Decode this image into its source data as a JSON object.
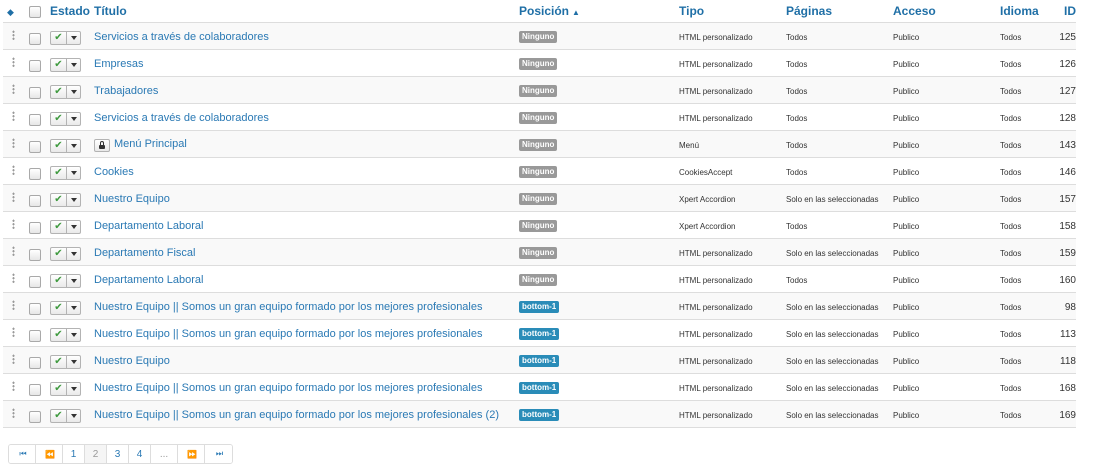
{
  "headers": {
    "estado": "Estado",
    "titulo": "Título",
    "posicion": "Posición",
    "tipo": "Tipo",
    "paginas": "Páginas",
    "acceso": "Acceso",
    "idioma": "Idioma",
    "id": "ID"
  },
  "rows": [
    {
      "title": "Servicios a través de colaboradores",
      "position": "Ninguno",
      "tipo": "HTML personalizado",
      "paginas": "Todos",
      "acceso": "Publico",
      "idioma": "Todos",
      "id": "125"
    },
    {
      "title": "Empresas",
      "position": "Ninguno",
      "tipo": "HTML personalizado",
      "paginas": "Todos",
      "acceso": "Publico",
      "idioma": "Todos",
      "id": "126"
    },
    {
      "title": "Trabajadores",
      "position": "Ninguno",
      "tipo": "HTML personalizado",
      "paginas": "Todos",
      "acceso": "Publico",
      "idioma": "Todos",
      "id": "127"
    },
    {
      "title": "Servicios a través de colaboradores",
      "position": "Ninguno",
      "tipo": "HTML personalizado",
      "paginas": "Todos",
      "acceso": "Publico",
      "idioma": "Todos",
      "id": "128"
    },
    {
      "title": "Menú Principal",
      "position": "Ninguno",
      "tipo": "Menú",
      "paginas": "Todos",
      "acceso": "Publico",
      "idioma": "Todos",
      "id": "143",
      "locked": true
    },
    {
      "title": "Cookies",
      "position": "Ninguno",
      "tipo": "CookiesAccept",
      "paginas": "Todos",
      "acceso": "Publico",
      "idioma": "Todos",
      "id": "146"
    },
    {
      "title": "Nuestro Equipo",
      "position": "Ninguno",
      "tipo": "Xpert Accordion",
      "paginas": "Solo en las seleccionadas",
      "acceso": "Publico",
      "idioma": "Todos",
      "id": "157"
    },
    {
      "title": "Departamento Laboral",
      "position": "Ninguno",
      "tipo": "Xpert Accordion",
      "paginas": "Todos",
      "acceso": "Publico",
      "idioma": "Todos",
      "id": "158"
    },
    {
      "title": "Departamento Fiscal",
      "position": "Ninguno",
      "tipo": "HTML personalizado",
      "paginas": "Solo en las seleccionadas",
      "acceso": "Publico",
      "idioma": "Todos",
      "id": "159"
    },
    {
      "title": "Departamento Laboral",
      "position": "Ninguno",
      "tipo": "HTML personalizado",
      "paginas": "Todos",
      "acceso": "Publico",
      "idioma": "Todos",
      "id": "160"
    },
    {
      "title": "Nuestro Equipo || Somos un gran equipo formado por los mejores profesionales",
      "position": "bottom-1",
      "tipo": "HTML personalizado",
      "paginas": "Solo en las seleccionadas",
      "acceso": "Publico",
      "idioma": "Todos",
      "id": "98"
    },
    {
      "title": "Nuestro Equipo || Somos un gran equipo formado por los mejores profesionales",
      "position": "bottom-1",
      "tipo": "HTML personalizado",
      "paginas": "Solo en las seleccionadas",
      "acceso": "Publico",
      "idioma": "Todos",
      "id": "113"
    },
    {
      "title": "Nuestro Equipo",
      "position": "bottom-1",
      "tipo": "HTML personalizado",
      "paginas": "Solo en las seleccionadas",
      "acceso": "Publico",
      "idioma": "Todos",
      "id": "118"
    },
    {
      "title": "Nuestro Equipo || Somos un gran equipo formado por los mejores profesionales",
      "position": "bottom-1",
      "tipo": "HTML personalizado",
      "paginas": "Solo en las seleccionadas",
      "acceso": "Publico",
      "idioma": "Todos",
      "id": "168"
    },
    {
      "title": "Nuestro Equipo || Somos un gran equipo formado por los mejores profesionales (2)",
      "position": "bottom-1",
      "tipo": "HTML personalizado",
      "paginas": "Solo en las seleccionadas",
      "acceso": "Publico",
      "idioma": "Todos",
      "id": "169"
    }
  ],
  "pagination": {
    "first": "⏮",
    "prev": "⏪",
    "pages": [
      "1",
      "2",
      "3",
      "4"
    ],
    "active_page": "2",
    "ellipsis": "...",
    "next": "⏩",
    "last": "⏭"
  },
  "colors": {
    "link": "#2a79b4",
    "badge_none": "#999999",
    "badge_position": "#2a8cb8",
    "published_check": "#3f9a3f"
  }
}
